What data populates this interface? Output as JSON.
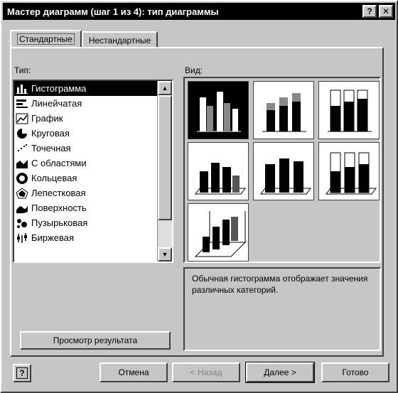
{
  "window": {
    "title": "Мастер диаграмм (шаг 1 из 4): тип диаграммы",
    "help_btn": "?",
    "close_btn": "✕"
  },
  "tabs": [
    "Стандартные",
    "Нестандартные"
  ],
  "type_label": "Тип:",
  "view_label": "Вид:",
  "types": [
    "Гистограмма",
    "Линейчатая",
    "График",
    "Круговая",
    "Точечная",
    "С областями",
    "Кольцевая",
    "Лепестковая",
    "Поверхность",
    "Пузырьковая",
    "Биржевая"
  ],
  "description": "Обычная гистограмма отображает значения различных категорий.",
  "preview_button": "Просмотр результата",
  "buttons": {
    "help": "?",
    "cancel": "Отмена",
    "back": "< Назад",
    "next": "Далее >",
    "finish": "Готово"
  }
}
